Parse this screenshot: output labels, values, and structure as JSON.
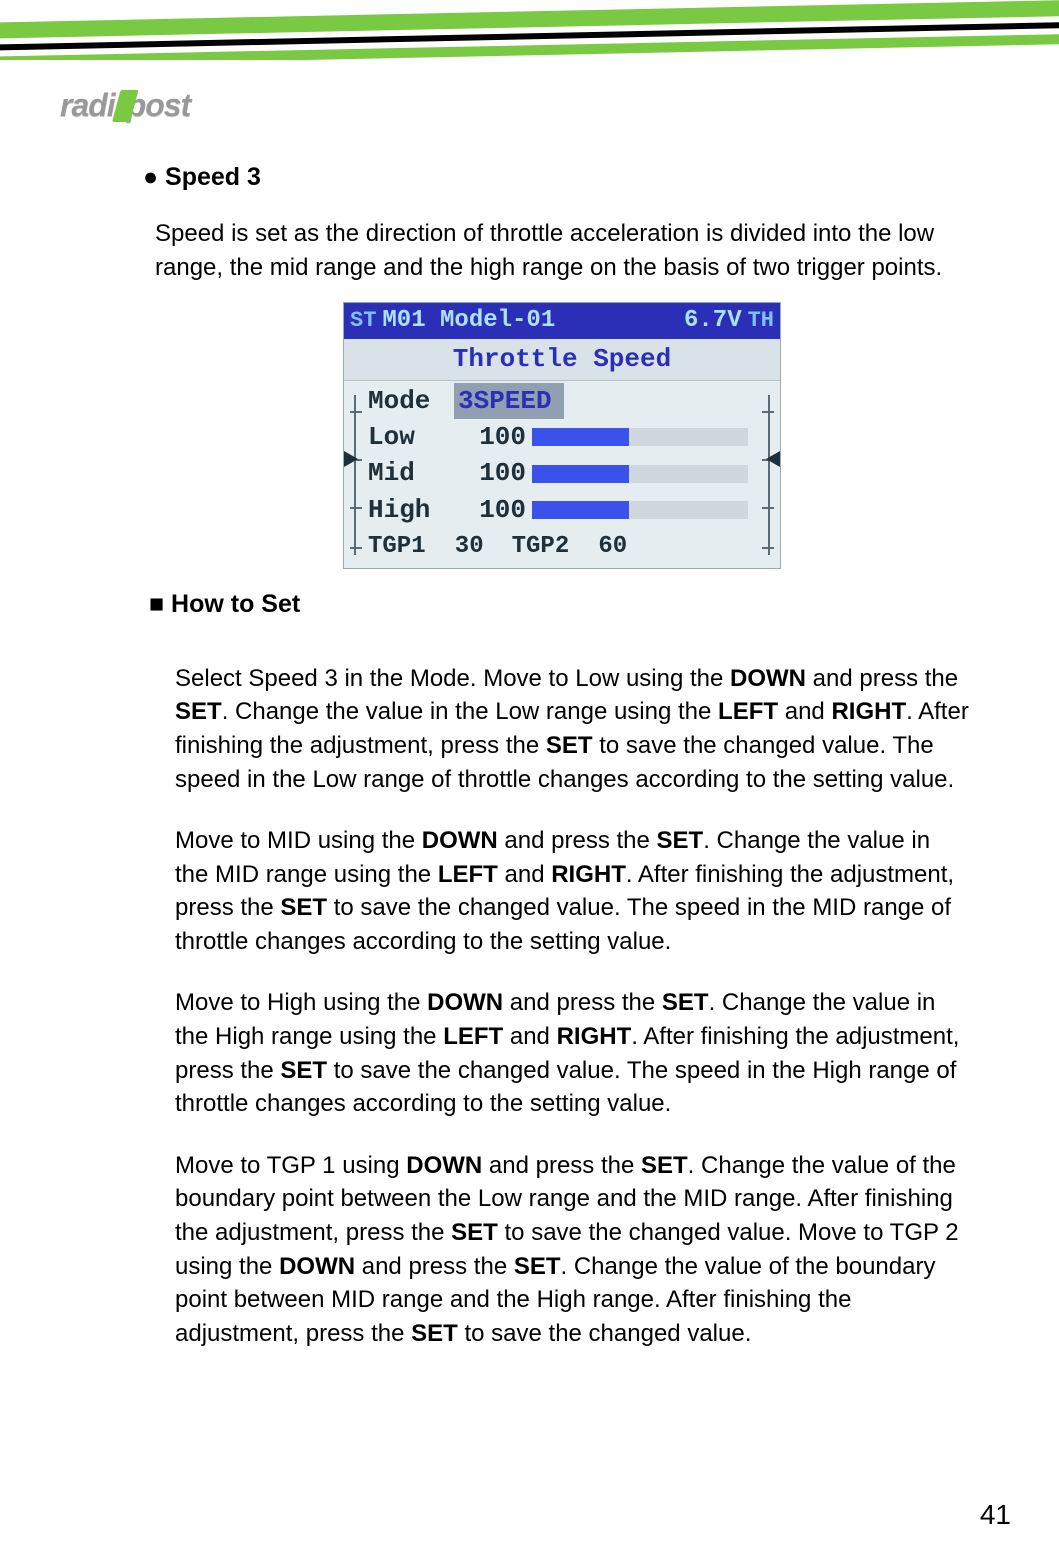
{
  "logo_text_left": "radi",
  "logo_text_right": "post",
  "heading_speed3": "Speed 3",
  "intro_text": "Speed is set as the direction of throttle acceleration is divided into the low range, the mid range and the high range on the basis of two trigger points.",
  "screen": {
    "st_left": "ST",
    "model": "M01 Model-01",
    "voltage": "6.7V",
    "st_right": "TH",
    "title": "Throttle Speed",
    "mode_label": "Mode",
    "mode_value": "3SPEED",
    "rows": [
      {
        "label": "Low",
        "value": "100",
        "fill_pct": 45
      },
      {
        "label": "Mid",
        "value": "100",
        "fill_pct": 45
      },
      {
        "label": "High",
        "value": "100",
        "fill_pct": 45
      }
    ],
    "tgp1_label": "TGP1",
    "tgp1_value": "30",
    "tgp2_label": "TGP2",
    "tgp2_value": "60"
  },
  "heading_howto": "How to Set",
  "para1": "Select Speed 3 in the Mode. Move to Low using the <b>DOWN</b> and press the <b>SET</b>. Change the value in the Low range using the <b>LEFT</b> and <b>RIGHT</b>. After finishing the adjustment, press the <b>SET</b> to save the changed value.  The speed in the Low range of throttle changes according to the setting value.",
  "para2": "Move to MID using the <b>DOWN</b> and press the <b>SET</b>. Change the value in the MID range using the <b>LEFT</b> and <b>RIGHT</b>.  After finishing the adjustment, press the <b>SET</b> to save the changed value.  The speed in the MID range of throttle changes according to the setting value.",
  "para3": "Move to High using the <b>DOWN</b> and press the <b>SET</b>. Change the value in the High range using the <b>LEFT</b> and <b>RIGHT</b>. After finishing the adjustment, press the <b>SET</b> to save the changed value. The speed in the High range of throttle changes according to the setting value.",
  "para4": "Move to TGP 1 using <b>DOWN</b> and press the <b>SET</b>. Change the value of the boundary point between the Low range and the MID range.  After finishing the adjustment, press the <b>SET</b> to save the changed value.  Move to TGP 2 using the <b>DOWN</b> and press the <b>SET</b>.  Change the value of the boundary point between MID range and the High range.  After finishing the adjustment, press the <b>SET</b> to save the changed value.",
  "page_number": "41"
}
